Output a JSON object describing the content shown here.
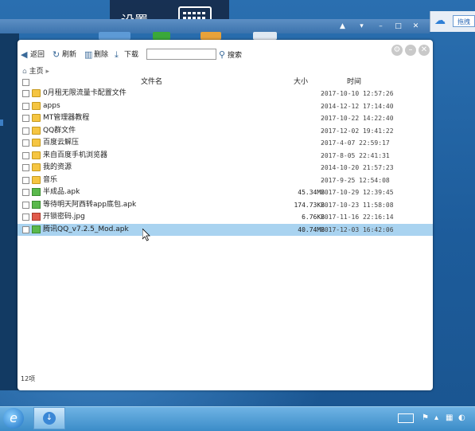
{
  "overlay": {
    "settings_label": "设置"
  },
  "host": {
    "button_label": "拖拽"
  },
  "toolbar": {
    "back_label": "返回",
    "refresh_label": "刷新",
    "delete_label": "删除",
    "download_label": "下载",
    "search_value": "",
    "search_label": "搜索"
  },
  "breadcrumb": {
    "home_label": "主页"
  },
  "columns": {
    "name": "文件名",
    "size": "大小",
    "time": "时间"
  },
  "files": [
    {
      "name": "0月租无限流量卡配置文件",
      "type": "folder",
      "size": "-",
      "time": "2017-10-10 12:57:26",
      "selected": false
    },
    {
      "name": "apps",
      "type": "folder",
      "size": "-",
      "time": "2014-12-12 17:14:40",
      "selected": false
    },
    {
      "name": "MT管理器教程",
      "type": "folder",
      "size": "-",
      "time": "2017-10-22 14:22:40",
      "selected": false
    },
    {
      "name": "QQ群文件",
      "type": "folder",
      "size": "-",
      "time": "2017-12-02 19:41:22",
      "selected": false
    },
    {
      "name": "百度云解压",
      "type": "folder",
      "size": "-",
      "time": "2017-4-07 22:59:17",
      "selected": false
    },
    {
      "name": "来自百度手机浏览器",
      "type": "folder",
      "size": "-",
      "time": "2017-8-05 22:41:31",
      "selected": false
    },
    {
      "name": "我的资源",
      "type": "folder",
      "size": "-",
      "time": "2014-10-20 21:57:23",
      "selected": false
    },
    {
      "name": "音乐",
      "type": "folder",
      "size": "-",
      "time": "2017-9-25 12:54:08",
      "selected": false
    },
    {
      "name": "半成品.apk",
      "type": "apk",
      "size": "45.34MB",
      "time": "2017-10-29 12:39:45",
      "selected": false
    },
    {
      "name": "等待明天阿西转app底包.apk",
      "type": "apk",
      "size": "174.73KB",
      "time": "2017-10-23 11:58:08",
      "selected": false
    },
    {
      "name": "开锁密码.jpg",
      "type": "jpg",
      "size": "6.76KB",
      "time": "2017-11-16 22:16:14",
      "selected": false
    },
    {
      "name": "腾讯QQ_v7.2.5_Mod.apk",
      "type": "apk",
      "size": "40.74MB",
      "time": "2017-12-03 16:42:06",
      "selected": true
    }
  ],
  "status": {
    "item_count": "12项"
  }
}
